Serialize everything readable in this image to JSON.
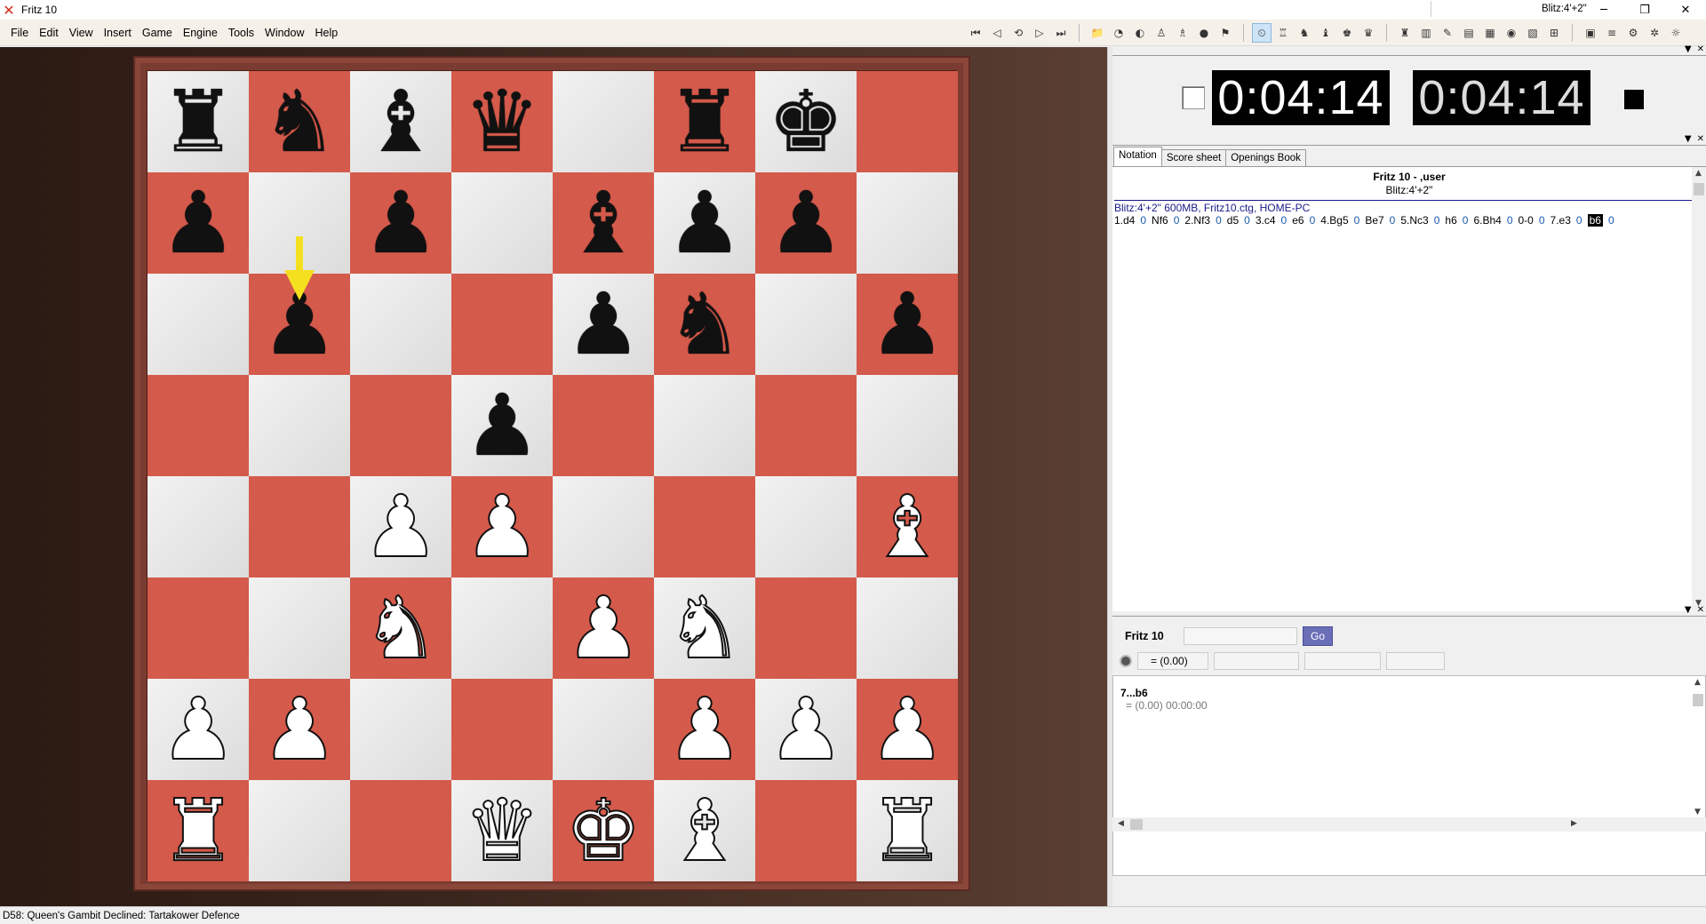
{
  "window": {
    "title": "Fritz 10",
    "controls": {
      "minimize": "─",
      "maximize": "❐",
      "close": "✕"
    }
  },
  "menu": [
    {
      "label": "File"
    },
    {
      "label": "Edit"
    },
    {
      "label": "View"
    },
    {
      "label": "Insert"
    },
    {
      "label": "Game"
    },
    {
      "label": "Engine"
    },
    {
      "label": "Tools"
    },
    {
      "label": "Window"
    },
    {
      "label": "Help"
    }
  ],
  "toolbar": {
    "nav": [
      "⏮",
      "◁",
      "⟲",
      "▷",
      "⏭"
    ],
    "group2": [
      "📁",
      "◔",
      "◐",
      "♙",
      "♗",
      "●",
      "⚑"
    ],
    "group3": [
      "⏲",
      "♖",
      "♞",
      "♝",
      "♚",
      "♛"
    ],
    "group4": [
      "♜",
      "▥",
      "✎",
      "▤",
      "▦",
      "◉",
      "▧",
      "⊞"
    ],
    "group5": [
      "▣",
      "≡",
      "⚙",
      "✲",
      "☼"
    ]
  },
  "clocks": {
    "white_time": "0:04:14",
    "black_time": "0:04:14"
  },
  "board": {
    "ranks": [
      [
        "r",
        "n",
        "b",
        "q",
        "",
        "r",
        "k",
        ""
      ],
      [
        "p",
        "",
        "p",
        "",
        "b",
        "p",
        "p",
        ""
      ],
      [
        "",
        "p",
        "",
        "",
        "p",
        "n",
        "",
        "p"
      ],
      [
        "",
        "",
        "",
        "p",
        "",
        "",
        "",
        ""
      ],
      [
        "",
        "",
        "P",
        "P",
        "",
        "",
        "",
        "B"
      ],
      [
        "",
        "",
        "N",
        "",
        "P",
        "N",
        "",
        ""
      ],
      [
        "P",
        "P",
        "",
        "",
        "",
        "P",
        "P",
        "P"
      ],
      [
        "R",
        "",
        "",
        "Q",
        "K",
        "B",
        "",
        "R"
      ]
    ],
    "last_move_arrow_square": "b6"
  },
  "notation": {
    "tabs": [
      "Notation",
      "Score sheet",
      "Openings Book"
    ],
    "active_tab": "Notation",
    "players": "Fritz 10 - ,user",
    "time_control": "Blitz:4'+2\"",
    "game_info": "Blitz:4'+2\"   600MB, Fritz10.ctg, HOME-PC",
    "moves": [
      {
        "m": "1.d4"
      },
      {
        "m": "Nf6"
      },
      {
        "m": "2.Nf3"
      },
      {
        "m": "d5"
      },
      {
        "m": "3.c4"
      },
      {
        "m": "e6"
      },
      {
        "m": "4.Bg5"
      },
      {
        "m": "Be7"
      },
      {
        "m": "5.Nc3"
      },
      {
        "m": "h6"
      },
      {
        "m": "6.Bh4"
      },
      {
        "m": "0-0"
      },
      {
        "m": "7.e3"
      },
      {
        "m": "b6",
        "current": true
      }
    ],
    "move_time": "0"
  },
  "engine": {
    "name": "Fritz 10",
    "go_label": "Go",
    "eval_field": "=  (0.00)",
    "line_move": "7...b6",
    "line_eval": "=  (0.00)     00:00:00"
  },
  "status": {
    "opening": "D58: Queen's Gambit Declined: Tartakower Defence",
    "right": "Blitz:4'+2\""
  },
  "colors": {
    "light_square": "#e8e8e8",
    "dark_square": "#d45a4b",
    "arrow": "#f5e020",
    "go_button": "#6b6fb8"
  }
}
